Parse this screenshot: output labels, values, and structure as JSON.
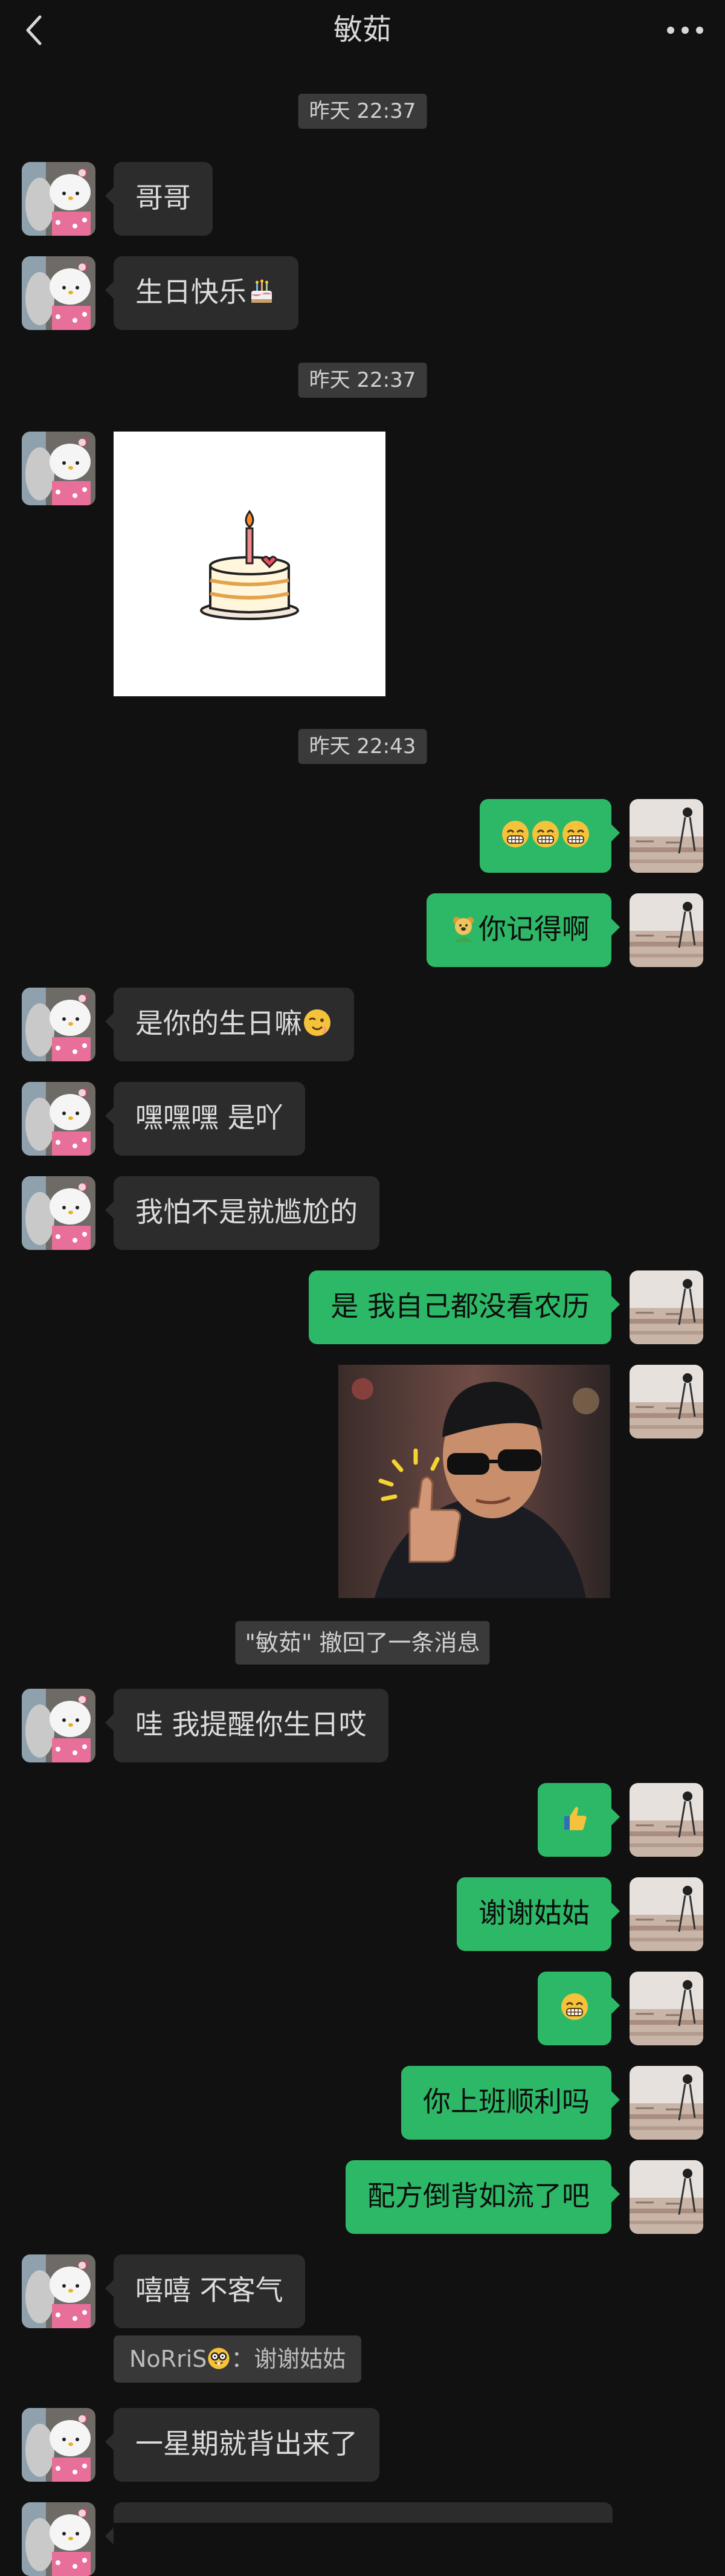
{
  "header": {
    "title": "敏茹",
    "back_icon": "chevron-left-icon",
    "more_icon": "more-horizontal-icon"
  },
  "timestamps": [
    "昨天 22:37",
    "昨天 22:37",
    "昨天 22:43"
  ],
  "messages": [
    {
      "text": "哥哥"
    },
    {
      "text": "生日快乐",
      "emoji": "cake-emoji"
    },
    {
      "image": "birthday-cake-sticker"
    },
    {
      "emoji_only": [
        "grin-emoji",
        "grin-emoji",
        "grin-emoji"
      ]
    },
    {
      "text": "你记得啊",
      "emoji_prefix": "bear-emoji"
    },
    {
      "text": "是你的生日嘛",
      "emoji": "wink-emoji"
    },
    {
      "text": "嘿嘿嘿 是吖"
    },
    {
      "text": "我怕不是就尴尬的"
    },
    {
      "text": "是 我自己都没看农历"
    },
    {
      "image": "thumbs-up-sunglasses-meme"
    },
    {
      "text": "哇 我提醒你生日哎"
    },
    {
      "emoji_only": [
        "thumbs-up-emoji"
      ]
    },
    {
      "text": "谢谢姑姑"
    },
    {
      "emoji_only": [
        "grin-emoji"
      ]
    },
    {
      "text": "你上班顺利吗"
    },
    {
      "text": "配方倒背如流了吧"
    },
    {
      "text": "嘻嘻 不客气"
    },
    {
      "text": "一星期就背出来了"
    }
  ],
  "recall_notice": "\"敏茹\" 撤回了一条消息",
  "quote": {
    "text": "NoRriS",
    "suffix": "：谢谢姑姑",
    "emoji": "nerd-emoji"
  },
  "colors": {
    "background": "#111111",
    "bubble_in": "#2c2c2c",
    "bubble_out": "#2db867"
  }
}
